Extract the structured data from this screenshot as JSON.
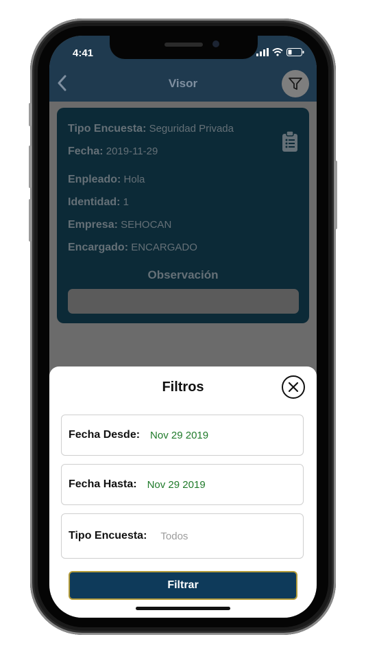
{
  "status_bar": {
    "time": "4:41"
  },
  "nav": {
    "title": "Visor"
  },
  "card": {
    "rows": [
      {
        "label": "Tipo Encuesta:",
        "value": "Seguridad Privada"
      },
      {
        "label": "Fecha:",
        "value": "2019-11-29"
      },
      {
        "label": "Enpleado:",
        "value": "Hola"
      },
      {
        "label": "Identidad:",
        "value": "1"
      },
      {
        "label": "Empresa:",
        "value": "SEHOCAN"
      },
      {
        "label": "Encargado:",
        "value": "ENCARGADO"
      }
    ],
    "observation_title": "Observación",
    "observation_value": ""
  },
  "sheet": {
    "title": "Filtros",
    "fields": [
      {
        "label": "Fecha Desde:",
        "value": "Nov 29 2019"
      },
      {
        "label": "Fecha Hasta:",
        "value": "Nov 29 2019"
      },
      {
        "label": "Tipo Encuesta:",
        "value": "Todos"
      }
    ],
    "submit_label": "Filtrar"
  },
  "colors": {
    "header": "#1f3a4f",
    "card": "#0c2a37",
    "accent_value": "#1f7a2a",
    "button": "#0e3a5a",
    "button_border": "#b39b3a"
  },
  "icons": [
    "back-chevron-icon",
    "filter-funnel-icon",
    "clipboard-list-icon",
    "close-circle-icon",
    "signal-icon",
    "wifi-icon",
    "battery-icon"
  ]
}
